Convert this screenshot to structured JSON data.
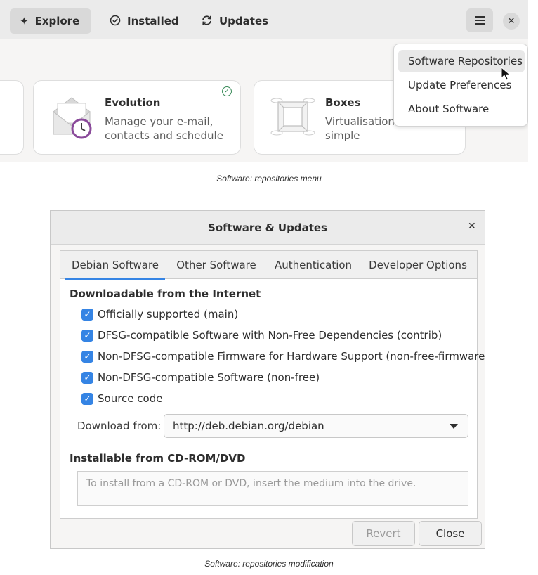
{
  "screenshot1": {
    "tabs": [
      {
        "label": "Explore",
        "icon": "sparkle-icon",
        "active": true
      },
      {
        "label": "Installed",
        "icon": "check-circle-icon",
        "active": false
      },
      {
        "label": "Updates",
        "icon": "refresh-icon",
        "active": false
      }
    ],
    "cards": [
      {
        "title": "Evolution",
        "description_line1": "Manage your e-mail,",
        "description_line2": "contacts and schedule",
        "icon": "mail-clock-icon",
        "installed": true
      },
      {
        "title": "Boxes",
        "description_line1": "Virtualisation",
        "description_line2": "simple",
        "icon": "boxes-icon",
        "installed": false
      }
    ],
    "menu": {
      "items": [
        {
          "label": "Software Repositories",
          "hovered": true
        },
        {
          "label": "Update Preferences",
          "hovered": false
        },
        {
          "label": "About Software",
          "hovered": false
        }
      ]
    },
    "caption": "Software: repositories menu"
  },
  "screenshot2": {
    "title": "Software & Updates",
    "tabs": [
      "Debian Software",
      "Other Software",
      "Authentication",
      "Developer Options"
    ],
    "active_tab": "Debian Software",
    "downloadable_heading": "Downloadable from the Internet",
    "checkboxes": [
      {
        "label": "Officially supported (main)",
        "checked": true
      },
      {
        "label": "DFSG-compatible Software with Non-Free Dependencies (contrib)",
        "checked": true
      },
      {
        "label": "Non-DFSG-compatible Firmware for Hardware Support (non-free-firmware)",
        "checked": true
      },
      {
        "label": "Non-DFSG-compatible Software (non-free)",
        "checked": true
      },
      {
        "label": "Source code",
        "checked": true
      }
    ],
    "download_from_label": "Download from:",
    "download_from_value": "http://deb.debian.org/debian",
    "cdrom_heading": "Installable from CD-ROM/DVD",
    "cdrom_text": "To install from a CD-ROM or DVD, insert the medium into the drive.",
    "revert_label": "Revert",
    "close_label": "Close",
    "caption": "Software: repositories modification"
  },
  "colors": {
    "accent": "#3584e4",
    "installed_check": "#3a8c5a",
    "disabled_text": "#9a9a9a"
  }
}
